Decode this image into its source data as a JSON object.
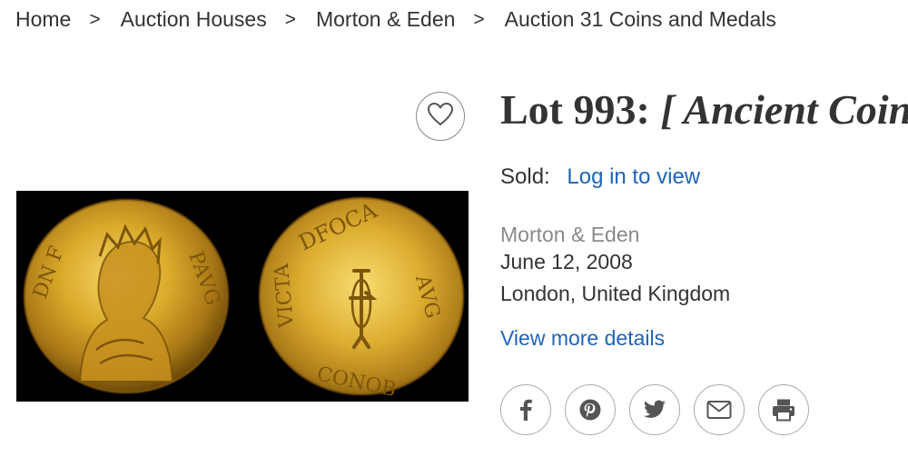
{
  "breadcrumb": {
    "items": [
      "Home",
      "Auction Houses",
      "Morton & Eden",
      "Auction 31 Coins and Medals"
    ],
    "separator": ">"
  },
  "lot": {
    "prefix": "Lot 993: ",
    "title_italic": "[ Ancient Coins",
    "sold_label": "Sold:",
    "sold_value_link": "Log in to view",
    "auction_house": "Morton & Eden",
    "date": "June 12, 2008",
    "location": "London, United Kingdom",
    "details_link": "View more details"
  },
  "icons": {
    "favorite": "heart-icon",
    "share": [
      "facebook-icon",
      "pinterest-icon",
      "twitter-icon",
      "email-icon",
      "print-icon"
    ]
  },
  "colors": {
    "link": "#1f64b8",
    "text": "#333333",
    "muted": "#8a8a8a",
    "icon": "#555555"
  }
}
